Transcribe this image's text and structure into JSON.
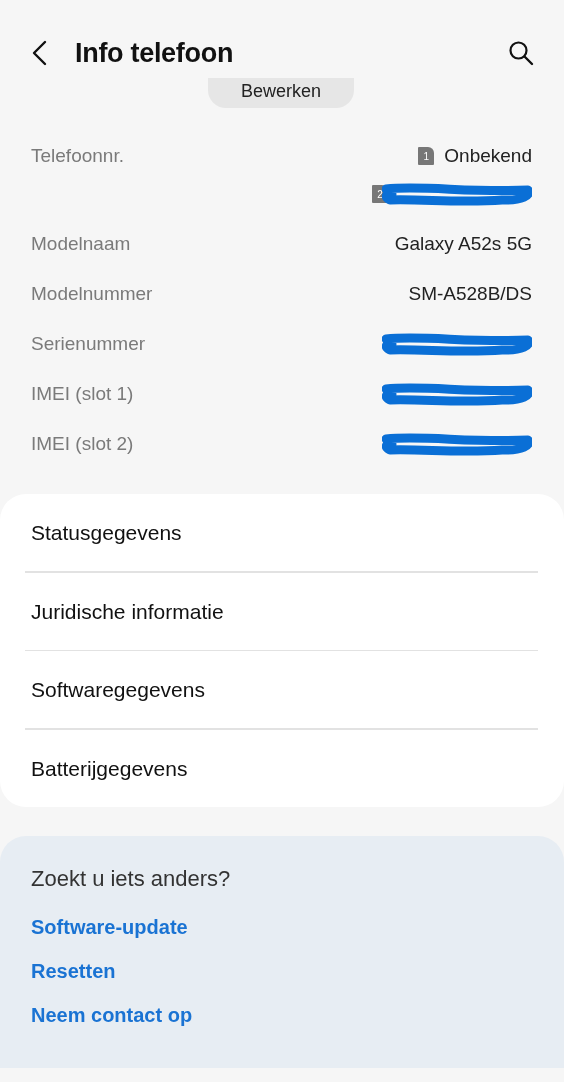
{
  "header": {
    "title": "Info telefoon"
  },
  "edit_button": {
    "label": "Bewerken"
  },
  "info_rows": [
    {
      "label": "Telefoonnr.",
      "lines": [
        {
          "sim": "1",
          "value": "Onbekend"
        },
        {
          "sim": "2",
          "redacted": true
        }
      ]
    },
    {
      "label": "Modelnaam",
      "lines": [
        {
          "value": "Galaxy A52s 5G"
        }
      ]
    },
    {
      "label": "Modelnummer",
      "lines": [
        {
          "value": "SM-A528B/DS"
        }
      ]
    },
    {
      "label": "Serienummer",
      "lines": [
        {
          "redacted": true
        }
      ]
    },
    {
      "label": "IMEI (slot 1)",
      "lines": [
        {
          "redacted": true
        }
      ]
    },
    {
      "label": "IMEI (slot 2)",
      "lines": [
        {
          "redacted": true
        }
      ]
    }
  ],
  "menu_items": [
    "Statusgegevens",
    "Juridische informatie",
    "Softwaregegevens",
    "Batterijgegevens"
  ],
  "suggestions": {
    "heading": "Zoekt u iets anders?",
    "links": [
      "Software-update",
      "Resetten",
      "Neem contact op"
    ]
  }
}
